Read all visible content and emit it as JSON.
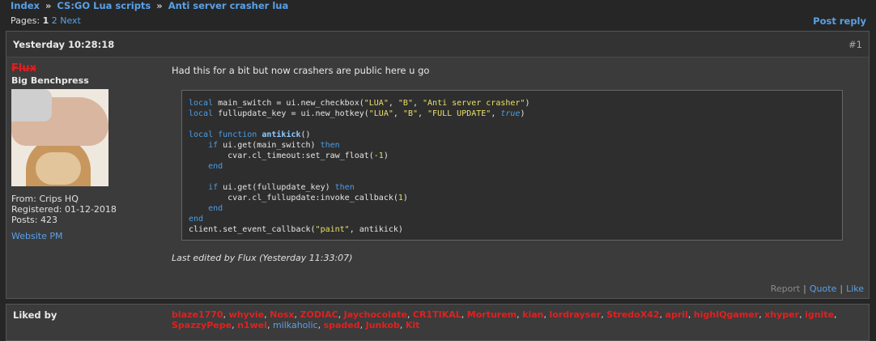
{
  "breadcrumb": [
    "Index",
    "CS:GO Lua scripts",
    "Anti server crasher lua"
  ],
  "breadcrumb_sep": "»",
  "pagination": {
    "label": "Pages:",
    "current": "1",
    "next_page": "2",
    "next_label": "Next"
  },
  "post_reply": "Post reply",
  "post": {
    "date": "Yesterday 10:28:18",
    "number": "#1",
    "author": {
      "name": "Flux",
      "title": "Big Benchpress",
      "from": "From: Crips HQ",
      "registered": "Registered: 01-12-2018",
      "posts": "Posts: 423",
      "website": "Website",
      "pm": "PM"
    },
    "message": "Had this for a bit but now crashers are public here u go",
    "edited": "Last edited by Flux (Yesterday 11:33:07)",
    "actions": {
      "report": "Report",
      "quote": "Quote",
      "like": "Like"
    }
  },
  "code_lines": [
    "local main_switch = ui.new_checkbox(\"LUA\", \"B\", \"Anti server crasher\")",
    "local fullupdate_key = ui.new_hotkey(\"LUA\", \"B\", \"FULL UPDATE\", true)",
    "",
    "local function antikick()",
    "    if ui.get(main_switch) then",
    "        cvar.cl_timeout:set_raw_float(-1)",
    "    end",
    "",
    "    if ui.get(fullupdate_key) then",
    "        cvar.cl_fullupdate:invoke_callback(1)",
    "    end",
    "end",
    "client.set_event_callback(\"paint\", antikick)"
  ],
  "liked_by": {
    "label": "Liked by",
    "users": [
      {
        "name": "blaze1770",
        "style": "red"
      },
      {
        "name": "whyvie",
        "style": "red"
      },
      {
        "name": "Nosx",
        "style": "red"
      },
      {
        "name": "ZODIAC",
        "style": "red"
      },
      {
        "name": "Jaychocolate",
        "style": "red"
      },
      {
        "name": "CR1TIKAL",
        "style": "red"
      },
      {
        "name": "Morturem",
        "style": "red"
      },
      {
        "name": "kian",
        "style": "red"
      },
      {
        "name": "lordrayser",
        "style": "red"
      },
      {
        "name": "StredoX42",
        "style": "red"
      },
      {
        "name": "april",
        "style": "red"
      },
      {
        "name": "highIQgamer",
        "style": "red"
      },
      {
        "name": "xhyper",
        "style": "red"
      },
      {
        "name": "ignite",
        "style": "red"
      },
      {
        "name": "SpazzyPepe",
        "style": "red"
      },
      {
        "name": "n1wel",
        "style": "red"
      },
      {
        "name": "milkaholic",
        "style": "blue"
      },
      {
        "name": "spaded",
        "style": "red"
      },
      {
        "name": "Junkob",
        "style": "red"
      },
      {
        "name": "Kit",
        "style": "red"
      }
    ]
  },
  "colors": {
    "link": "#5aa0e6",
    "username_red": "#e02020",
    "background": "#262626",
    "panel": "#3b3b3b"
  }
}
